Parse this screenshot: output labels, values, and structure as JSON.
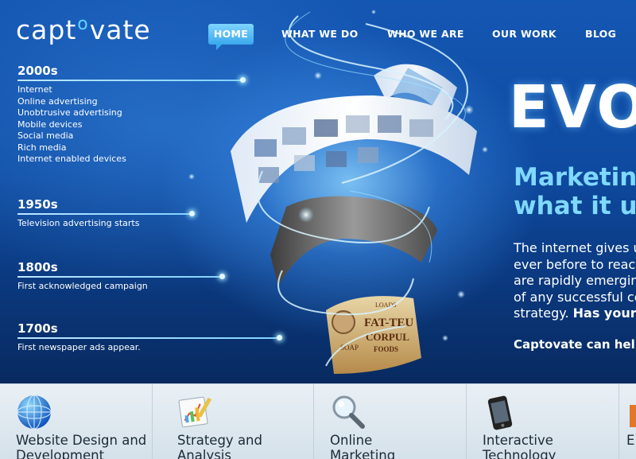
{
  "brand": {
    "logo_pre": "capt",
    "logo_o": "o",
    "logo_post": "vate"
  },
  "nav": {
    "items": [
      "HOME",
      "WHAT WE DO",
      "WHO WE ARE",
      "OUR WORK",
      "BLOG"
    ],
    "active": "HOME"
  },
  "timeline": [
    {
      "year": "2000s",
      "items": [
        "Internet",
        "Online advertising",
        "Unobtrusive advertising",
        "Mobile devices",
        "Social media",
        "Rich media",
        "Internet enabled devices"
      ]
    },
    {
      "year": "1950s",
      "caption": "Television advertising starts"
    },
    {
      "year": "1800s",
      "caption": "First acknowledged campaign"
    },
    {
      "year": "1700s",
      "caption": "First newspaper ads appear."
    }
  ],
  "hero": {
    "headline": "EVOL",
    "tagline_1": "Marketing",
    "tagline_2": "what it us",
    "body_1": "The internet gives u",
    "body_2": "ever before to reach",
    "body_3": "are rapidly emergin",
    "body_4": "of any successful co",
    "body_5_pre": "strategy. ",
    "body_5_bold": "Has your r",
    "cta": "Captovate can help"
  },
  "spiral_labels": {
    "fat": "FAT-TEU",
    "corpul": "CORPUL",
    "foods": "FOODS",
    "loads": "LOADS",
    "soap": "SOAP"
  },
  "services": [
    {
      "line1": "Website Design and",
      "line2": "Development",
      "icon": "globe-icon"
    },
    {
      "line1": "Strategy and",
      "line2": "Analysis",
      "icon": "chart-icon"
    },
    {
      "line1": "Online",
      "line2": "Marketing",
      "icon": "magnifier-icon"
    },
    {
      "line1": "Interactive",
      "line2": "Technology",
      "icon": "phone-icon"
    },
    {
      "line1": "E",
      "line2": "",
      "icon": "partial-icon"
    }
  ],
  "colors": {
    "accent": "#3aa8ec",
    "tagline": "#7fd8ff",
    "hero_bg": "#0e4aa0",
    "service_bg": "#e0e9f0"
  }
}
